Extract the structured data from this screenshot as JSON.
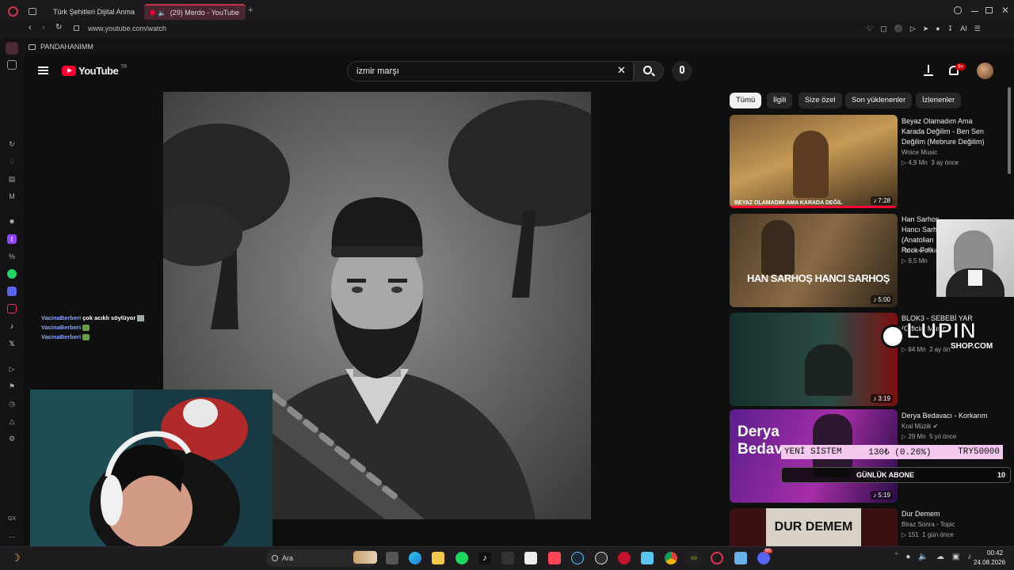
{
  "browser": {
    "tabs": [
      {
        "label": "Türk Şehitleri Dijital Anma"
      },
      {
        "label": "(29) Merdo - YouTube"
      }
    ],
    "url": "www.youtube.com/watch",
    "bookmark": "PANDAHANIMM",
    "toolbar_ai": "AI"
  },
  "youtube": {
    "logo": "YouTube",
    "region": "TR",
    "search_value": "izmir marşı",
    "notification_badge": "9+"
  },
  "chips": [
    {
      "label": "Tümü",
      "active": true
    },
    {
      "label": "İlgili",
      "active": false
    },
    {
      "label": "Size özel",
      "active": false
    },
    {
      "label": "Son yüklenenler",
      "active": false
    },
    {
      "label": "İzlenenler",
      "active": false
    }
  ],
  "recommendations": [
    {
      "title": "Beyaz Olamadım Ama Karada Değilim - Ben Sen Değilim (Mebrure Değilim)",
      "channel": "Woice Music",
      "views": "4,9 Mn",
      "age": "3 ay önce",
      "duration": "7:28",
      "thumb_text": "BEYAZ OLAMADIM AMA KARADA DEĞİL"
    },
    {
      "title": "Han Sarhoş Hancı Sarhoş (Anatolian Rock-Folk",
      "channel": "Pulse of Ana",
      "views": "9,5 Mn",
      "age": "",
      "duration": "5:00",
      "thumb_text": "HAN SARHOŞ  HANCI SARHOŞ"
    },
    {
      "title": "BLOK3 - SEBEBİ YAR (Official Music",
      "channel": "",
      "views": "84 Mn",
      "age": "2 ay ön",
      "duration": "3:19",
      "thumb_text": ""
    },
    {
      "title": "Derya Bedavacı - Korkarım",
      "channel": "Kral Müzik",
      "views": "29 Mn",
      "age": "5 yıl önce",
      "duration": "5:19",
      "thumb_text": "Derya Bedava"
    },
    {
      "title": "Dur Demem",
      "channel": "Biraz Sonra - Topic",
      "views": "151",
      "age": "1 gün önce",
      "duration": "",
      "thumb_text": "DUR DEMEM"
    }
  ],
  "chat": [
    {
      "user": "VacinaBerberi",
      "message": "çok acıklı söylüyor"
    },
    {
      "user": "VacinaBerberi",
      "message": ""
    },
    {
      "user": "VacinaBerberi",
      "message": ""
    }
  ],
  "overlays": {
    "ticker_left": "YENİ SİSTEM",
    "ticker_mid": "130₺ (0.26%)",
    "ticker_right": "TRY50000",
    "abone_label": "GÜNLÜK ABONE",
    "abone_count": "10",
    "lupin": "LUPIN",
    "lupin_shop": "SHOP.COM"
  },
  "taskbar": {
    "search_placeholder": "Ara",
    "time": "00:42",
    "date": "24.08.2026",
    "discord_badge": "99"
  },
  "sidebar": {
    "gx_label": "GX"
  },
  "colors": {
    "accent": "#ff0033",
    "chip_active": "#f1f1f1",
    "ticker_bg": "#f4c8ef"
  }
}
